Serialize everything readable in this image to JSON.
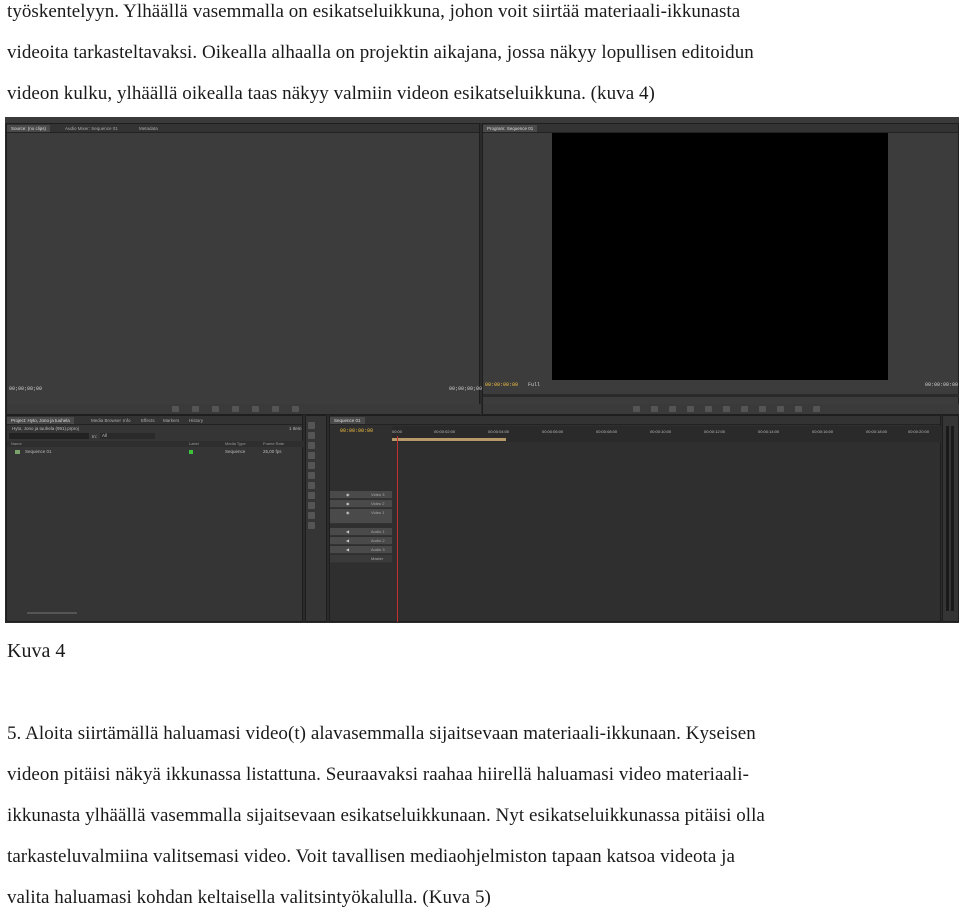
{
  "intro_lines": [
    "työskentelyyn. Ylhäällä vasemmalla on esikatseluikkuna, johon voit siirtää materiaali-ikkunasta",
    "videoita tarkasteltavaksi. Oikealla alhaalla on projektin aikajana, jossa näkyy lopullisen editoidun",
    "videon kulku, ylhäällä oikealla taas näkyy valmiin videon esikatseluikkuna. (kuva 4)"
  ],
  "caption": "Kuva 4",
  "body_lines": [
    "5. Aloita siirtämällä haluamasi video(t) alavasemmalla sijaitsevaan materiaali-ikkunaan. Kyseisen",
    "videon pitäisi näkyä ikkunassa listattuna. Seuraavaksi raahaa hiirellä haluamasi video materiaali-",
    "ikkunasta ylhäällä vasemmalla sijaitsevaan esikatseluikkunaan. Nyt esikatseluikkunassa pitäisi olla",
    "tarkasteluvalmiina valitsemasi video. Voit tavallisen mediaohjelmiston tapaan katsoa videota ja",
    "valita haluamasi kohdan keltaisella valitsintyökalulla. (Kuva 5)"
  ],
  "app": {
    "source_tabs": [
      "Source: (no clips)",
      "Audio Mixer: Sequence 01",
      "Metadata"
    ],
    "program_tab": "Program: Sequence 01",
    "source_tc_left": "00;00;00;00",
    "source_tc_right": "00;00;00;00",
    "program_tc_left": "00:00:00:00",
    "program_fit": "Full",
    "program_tc_right": "00:00:00:00",
    "project_tabs": [
      "Project: Hyto, Jono ja tuuhela",
      "Media Browser",
      "Info",
      "Effects",
      "Markers",
      "History"
    ],
    "project_file": "Hyto, Jono ja tuuhela (991).prproj",
    "project_count": "1 Item",
    "in_label": "In:",
    "in_value": "All",
    "columns": [
      "Name",
      "Label",
      "Media Type",
      "Frame Rate"
    ],
    "item": {
      "name": "Sequence 01",
      "type": "Sequence",
      "rate": "25,00 fps"
    },
    "sequence_tab": "Sequence 01",
    "timeline_tc": "00:00:00:00",
    "ruler": [
      "00:00",
      "00:00:02:00",
      "00:00:04:00",
      "00:00:06:00",
      "00:00:08:00",
      "00:00:10:00",
      "00:00:12:00",
      "00:00:14:00",
      "00:00:16:00",
      "00:00:18:00",
      "00:00:20:00",
      "00:00:22:00",
      "00:00:24:00"
    ],
    "video_tracks": [
      "Video 3",
      "Video 2",
      "Video 1"
    ],
    "audio_tracks": [
      "Audio 1",
      "Audio 2",
      "Audio 3",
      "Master"
    ]
  }
}
